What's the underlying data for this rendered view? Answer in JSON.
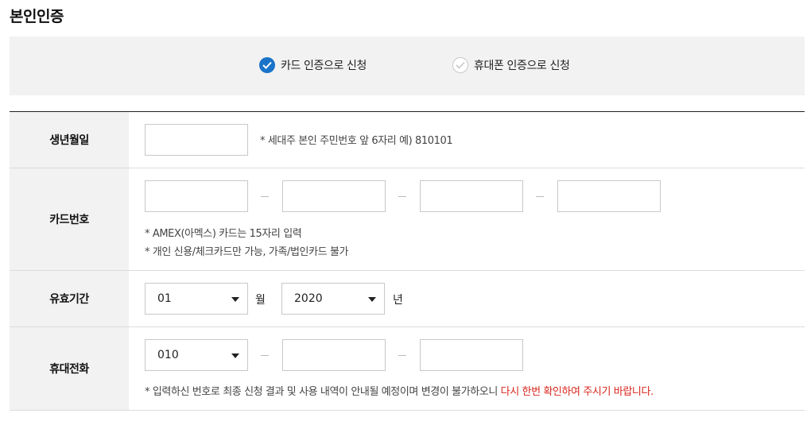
{
  "page_title": "본인인증",
  "method": {
    "card_label": "카드 인증으로 신청",
    "phone_label": "휴대폰 인증으로 신청",
    "selected": "card"
  },
  "birth": {
    "label": "생년월일",
    "value": "",
    "note": "* 세대주 본인 주민번호 앞 6자리 예) 810101"
  },
  "card": {
    "label": "카드번호",
    "fields": [
      "",
      "",
      "",
      ""
    ],
    "note1": "* AMEX(아멕스) 카드는 15자리 입력",
    "note2": "* 개인 신용/체크카드만 가능, 가족/법인카드 불가"
  },
  "expiry": {
    "label": "유효기간",
    "month": "01",
    "month_unit": "월",
    "year": "2020",
    "year_unit": "년"
  },
  "phone": {
    "label": "휴대전화",
    "prefix": "010",
    "middle": "",
    "last": "",
    "note_plain": "* 입력하신 번호로 최종 신청 결과 및 사용 내역이 안내될 예정이며 변경이 불가하오니 ",
    "note_red": "다시 한번 확인하여 주시기 바랍니다."
  },
  "colors": {
    "accent": "#1a73c9",
    "warning": "#d9251c"
  }
}
